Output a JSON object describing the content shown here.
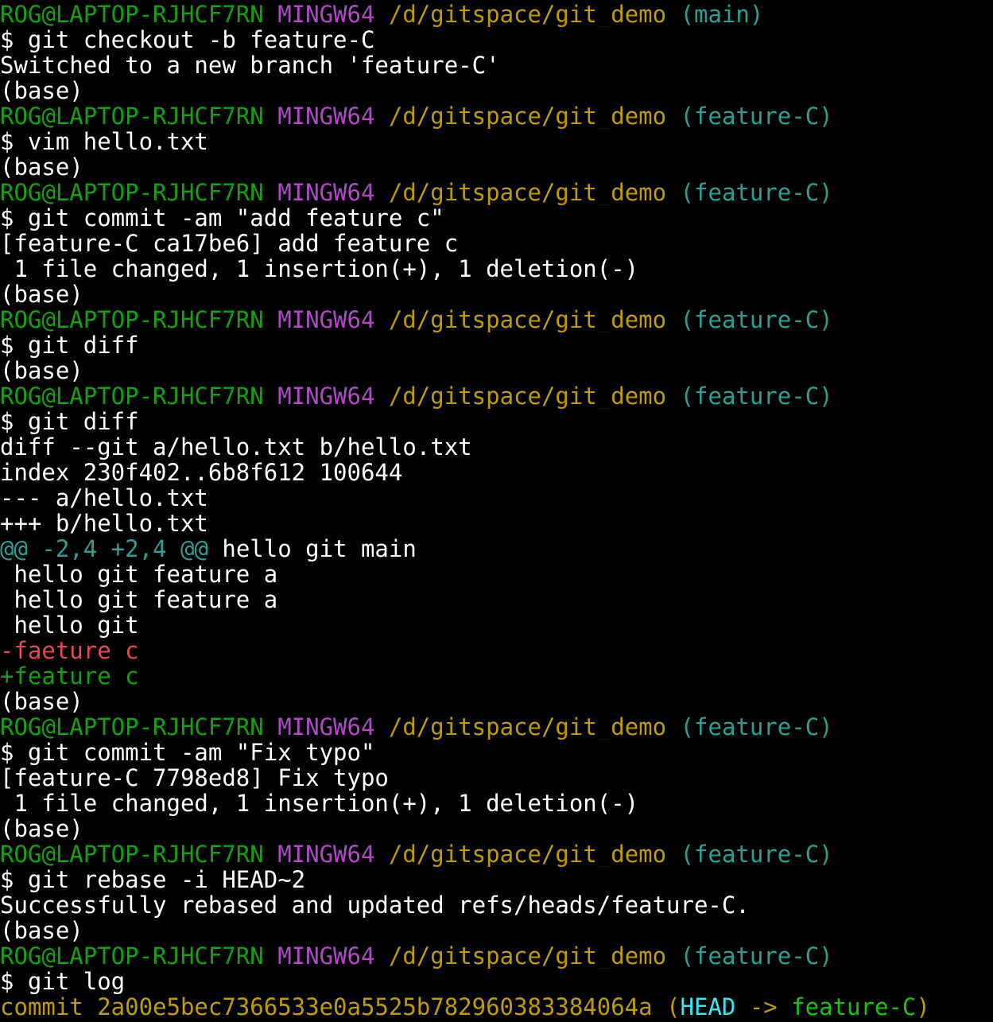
{
  "palette": {
    "white": "#ffffff",
    "green": "#13a10e",
    "magenta": "#b148c6",
    "yellow": "#c19c00",
    "cyan": "#2aa198",
    "red": "#e74856",
    "bcyan": "#3ae6f0",
    "bgreen": "#16c60c"
  },
  "lines": [
    {
      "kind": "prompt",
      "segments": [
        {
          "text": "ROG@LAPTOP-RJHCF7RN",
          "color": "green"
        },
        {
          "text": " ",
          "color": "white"
        },
        {
          "text": "MINGW64",
          "color": "magenta"
        },
        {
          "text": " ",
          "color": "white"
        },
        {
          "text": "/d/gitspace/git_demo",
          "color": "yellow"
        },
        {
          "text": " ",
          "color": "white"
        },
        {
          "text": "(main)",
          "color": "cyan"
        }
      ]
    },
    {
      "kind": "command",
      "segments": [
        {
          "text": "$ git checkout -b feature-C",
          "color": "white"
        }
      ]
    },
    {
      "kind": "output",
      "segments": [
        {
          "text": "Switched to a new branch 'feature-C'",
          "color": "white"
        }
      ]
    },
    {
      "kind": "output",
      "segments": [
        {
          "text": "(base)",
          "color": "white"
        }
      ]
    },
    {
      "kind": "prompt",
      "segments": [
        {
          "text": "ROG@LAPTOP-RJHCF7RN",
          "color": "green"
        },
        {
          "text": " ",
          "color": "white"
        },
        {
          "text": "MINGW64",
          "color": "magenta"
        },
        {
          "text": " ",
          "color": "white"
        },
        {
          "text": "/d/gitspace/git_demo",
          "color": "yellow"
        },
        {
          "text": " ",
          "color": "white"
        },
        {
          "text": "(feature-C)",
          "color": "cyan"
        }
      ]
    },
    {
      "kind": "command",
      "segments": [
        {
          "text": "$ vim hello.txt",
          "color": "white"
        }
      ]
    },
    {
      "kind": "output",
      "segments": [
        {
          "text": "(base)",
          "color": "white"
        }
      ]
    },
    {
      "kind": "prompt",
      "segments": [
        {
          "text": "ROG@LAPTOP-RJHCF7RN",
          "color": "green"
        },
        {
          "text": " ",
          "color": "white"
        },
        {
          "text": "MINGW64",
          "color": "magenta"
        },
        {
          "text": " ",
          "color": "white"
        },
        {
          "text": "/d/gitspace/git_demo",
          "color": "yellow"
        },
        {
          "text": " ",
          "color": "white"
        },
        {
          "text": "(feature-C)",
          "color": "cyan"
        }
      ]
    },
    {
      "kind": "command",
      "segments": [
        {
          "text": "$ git commit -am \"add feature c\"",
          "color": "white"
        }
      ]
    },
    {
      "kind": "output",
      "segments": [
        {
          "text": "[feature-C ca17be6] add feature c",
          "color": "white"
        }
      ]
    },
    {
      "kind": "output",
      "segments": [
        {
          "text": " 1 file changed, 1 insertion(+), 1 deletion(-)",
          "color": "white"
        }
      ]
    },
    {
      "kind": "output",
      "segments": [
        {
          "text": "(base)",
          "color": "white"
        }
      ]
    },
    {
      "kind": "prompt",
      "segments": [
        {
          "text": "ROG@LAPTOP-RJHCF7RN",
          "color": "green"
        },
        {
          "text": " ",
          "color": "white"
        },
        {
          "text": "MINGW64",
          "color": "magenta"
        },
        {
          "text": " ",
          "color": "white"
        },
        {
          "text": "/d/gitspace/git_demo",
          "color": "yellow"
        },
        {
          "text": " ",
          "color": "white"
        },
        {
          "text": "(feature-C)",
          "color": "cyan"
        }
      ]
    },
    {
      "kind": "command",
      "segments": [
        {
          "text": "$ git diff",
          "color": "white"
        }
      ]
    },
    {
      "kind": "output",
      "segments": [
        {
          "text": "(base)",
          "color": "white"
        }
      ]
    },
    {
      "kind": "prompt",
      "segments": [
        {
          "text": "ROG@LAPTOP-RJHCF7RN",
          "color": "green"
        },
        {
          "text": " ",
          "color": "white"
        },
        {
          "text": "MINGW64",
          "color": "magenta"
        },
        {
          "text": " ",
          "color": "white"
        },
        {
          "text": "/d/gitspace/git_demo",
          "color": "yellow"
        },
        {
          "text": " ",
          "color": "white"
        },
        {
          "text": "(feature-C)",
          "color": "cyan"
        }
      ]
    },
    {
      "kind": "command",
      "segments": [
        {
          "text": "$ git diff",
          "color": "white"
        }
      ]
    },
    {
      "kind": "diff-header",
      "segments": [
        {
          "text": "diff --git a/hello.txt b/hello.txt",
          "color": "white"
        }
      ]
    },
    {
      "kind": "diff-header",
      "segments": [
        {
          "text": "index 230f402..6b8f612 100644",
          "color": "white"
        }
      ]
    },
    {
      "kind": "diff-header",
      "segments": [
        {
          "text": "--- a/hello.txt",
          "color": "white"
        }
      ]
    },
    {
      "kind": "diff-header",
      "segments": [
        {
          "text": "+++ b/hello.txt",
          "color": "white"
        }
      ]
    },
    {
      "kind": "diff-hunk",
      "segments": [
        {
          "text": "@@ -2,4 +2,4 @@",
          "color": "cyan"
        },
        {
          "text": " hello git main",
          "color": "white"
        }
      ]
    },
    {
      "kind": "diff-context",
      "segments": [
        {
          "text": " hello git feature a",
          "color": "white"
        }
      ]
    },
    {
      "kind": "diff-context",
      "segments": [
        {
          "text": " hello git feature a",
          "color": "white"
        }
      ]
    },
    {
      "kind": "diff-context",
      "segments": [
        {
          "text": " hello git",
          "color": "white"
        }
      ]
    },
    {
      "kind": "diff-removed",
      "segments": [
        {
          "text": "-faeture c",
          "color": "red"
        }
      ]
    },
    {
      "kind": "diff-added",
      "segments": [
        {
          "text": "+feature c",
          "color": "green"
        }
      ]
    },
    {
      "kind": "output",
      "segments": [
        {
          "text": "(base)",
          "color": "white"
        }
      ]
    },
    {
      "kind": "prompt",
      "segments": [
        {
          "text": "ROG@LAPTOP-RJHCF7RN",
          "color": "green"
        },
        {
          "text": " ",
          "color": "white"
        },
        {
          "text": "MINGW64",
          "color": "magenta"
        },
        {
          "text": " ",
          "color": "white"
        },
        {
          "text": "/d/gitspace/git_demo",
          "color": "yellow"
        },
        {
          "text": " ",
          "color": "white"
        },
        {
          "text": "(feature-C)",
          "color": "cyan"
        }
      ]
    },
    {
      "kind": "command",
      "segments": [
        {
          "text": "$ git commit -am \"Fix typo\"",
          "color": "white"
        }
      ]
    },
    {
      "kind": "output",
      "segments": [
        {
          "text": "[feature-C 7798ed8] Fix typo",
          "color": "white"
        }
      ]
    },
    {
      "kind": "output",
      "segments": [
        {
          "text": " 1 file changed, 1 insertion(+), 1 deletion(-)",
          "color": "white"
        }
      ]
    },
    {
      "kind": "output",
      "segments": [
        {
          "text": "(base)",
          "color": "white"
        }
      ]
    },
    {
      "kind": "prompt",
      "segments": [
        {
          "text": "ROG@LAPTOP-RJHCF7RN",
          "color": "green"
        },
        {
          "text": " ",
          "color": "white"
        },
        {
          "text": "MINGW64",
          "color": "magenta"
        },
        {
          "text": " ",
          "color": "white"
        },
        {
          "text": "/d/gitspace/git_demo",
          "color": "yellow"
        },
        {
          "text": " ",
          "color": "white"
        },
        {
          "text": "(feature-C)",
          "color": "cyan"
        }
      ]
    },
    {
      "kind": "command",
      "segments": [
        {
          "text": "$ git rebase -i HEAD~2",
          "color": "white"
        }
      ]
    },
    {
      "kind": "output",
      "segments": [
        {
          "text": "Successfully rebased and updated refs/heads/feature-C.",
          "color": "white"
        }
      ]
    },
    {
      "kind": "output",
      "segments": [
        {
          "text": "(base)",
          "color": "white"
        }
      ]
    },
    {
      "kind": "prompt",
      "segments": [
        {
          "text": "ROG@LAPTOP-RJHCF7RN",
          "color": "green"
        },
        {
          "text": " ",
          "color": "white"
        },
        {
          "text": "MINGW64",
          "color": "magenta"
        },
        {
          "text": " ",
          "color": "white"
        },
        {
          "text": "/d/gitspace/git_demo",
          "color": "yellow"
        },
        {
          "text": " ",
          "color": "white"
        },
        {
          "text": "(feature-C)",
          "color": "cyan"
        }
      ]
    },
    {
      "kind": "command",
      "segments": [
        {
          "text": "$ git log",
          "color": "white"
        }
      ]
    },
    {
      "kind": "log-commit",
      "segments": [
        {
          "text": "commit 2a00e5bec7366533e0a5525b782960383384064a",
          "color": "yellow"
        },
        {
          "text": " (",
          "color": "yellow"
        },
        {
          "text": "HEAD",
          "color": "bcyan"
        },
        {
          "text": " -> ",
          "color": "yellow"
        },
        {
          "text": "feature-C",
          "color": "bgreen"
        },
        {
          "text": ")",
          "color": "yellow"
        }
      ]
    }
  ]
}
